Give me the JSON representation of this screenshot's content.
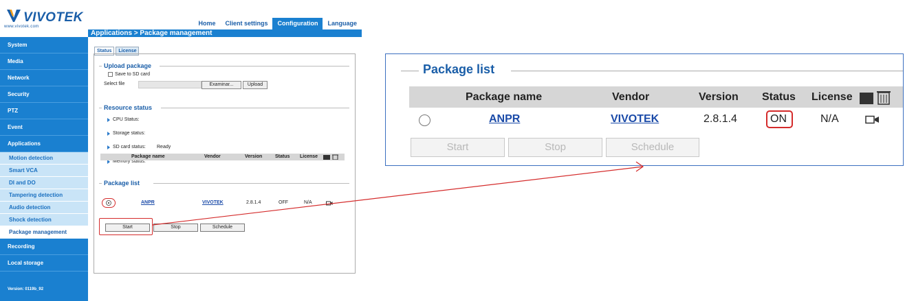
{
  "brand": {
    "name": "VIVOTEK",
    "url": "www.vivotek.com"
  },
  "topnav": {
    "home": "Home",
    "client_settings": "Client settings",
    "configuration": "Configuration",
    "language": "Language"
  },
  "breadcrumb": "Applications > Package management",
  "sidebar": {
    "system": "System",
    "media": "Media",
    "network": "Network",
    "security": "Security",
    "ptz": "PTZ",
    "event": "Event",
    "applications": "Applications",
    "sub": [
      "Motion detection",
      "Smart VCA",
      "DI and DO",
      "Tampering detection",
      "Audio detection",
      "Shock detection",
      "Package management"
    ],
    "recording": "Recording",
    "local_storage": "Local storage",
    "version": "Version: 0119b_92"
  },
  "tabs": {
    "status": "Status",
    "license": "License"
  },
  "upload": {
    "title": "Upload package",
    "save_sd": "Save to SD card",
    "select_file": "Select file",
    "browse": "Examinar...",
    "upload_btn": "Upload"
  },
  "resource": {
    "title": "Resource status",
    "cpu": "CPU Status:",
    "storage": "Storage status:",
    "sd_label": "SD card status:",
    "sd_value": "Ready",
    "memory": "Memory status:"
  },
  "package_list": {
    "title": "Package list",
    "headers": {
      "name": "Package name",
      "vendor": "Vendor",
      "version": "Version",
      "status": "Status",
      "license": "License"
    },
    "row": {
      "name": "ANPR",
      "vendor": "VIVOTEK",
      "version": "2.8.1.4",
      "status": "OFF",
      "license": "N/A"
    },
    "buttons": {
      "start": "Start",
      "stop": "Stop",
      "schedule": "Schedule"
    }
  },
  "zoom": {
    "title": "Package list",
    "headers": {
      "name": "Package name",
      "vendor": "Vendor",
      "version": "Version",
      "status": "Status",
      "license": "License"
    },
    "row": {
      "name": "ANPR",
      "vendor": "VIVOTEK",
      "version": "2.8.1.4",
      "status": "ON",
      "license": "N/A"
    },
    "buttons": {
      "start": "Start",
      "stop": "Stop",
      "schedule": "Schedule"
    }
  },
  "colors": {
    "accent": "#1a80d0",
    "highlight": "#d42a2a"
  }
}
